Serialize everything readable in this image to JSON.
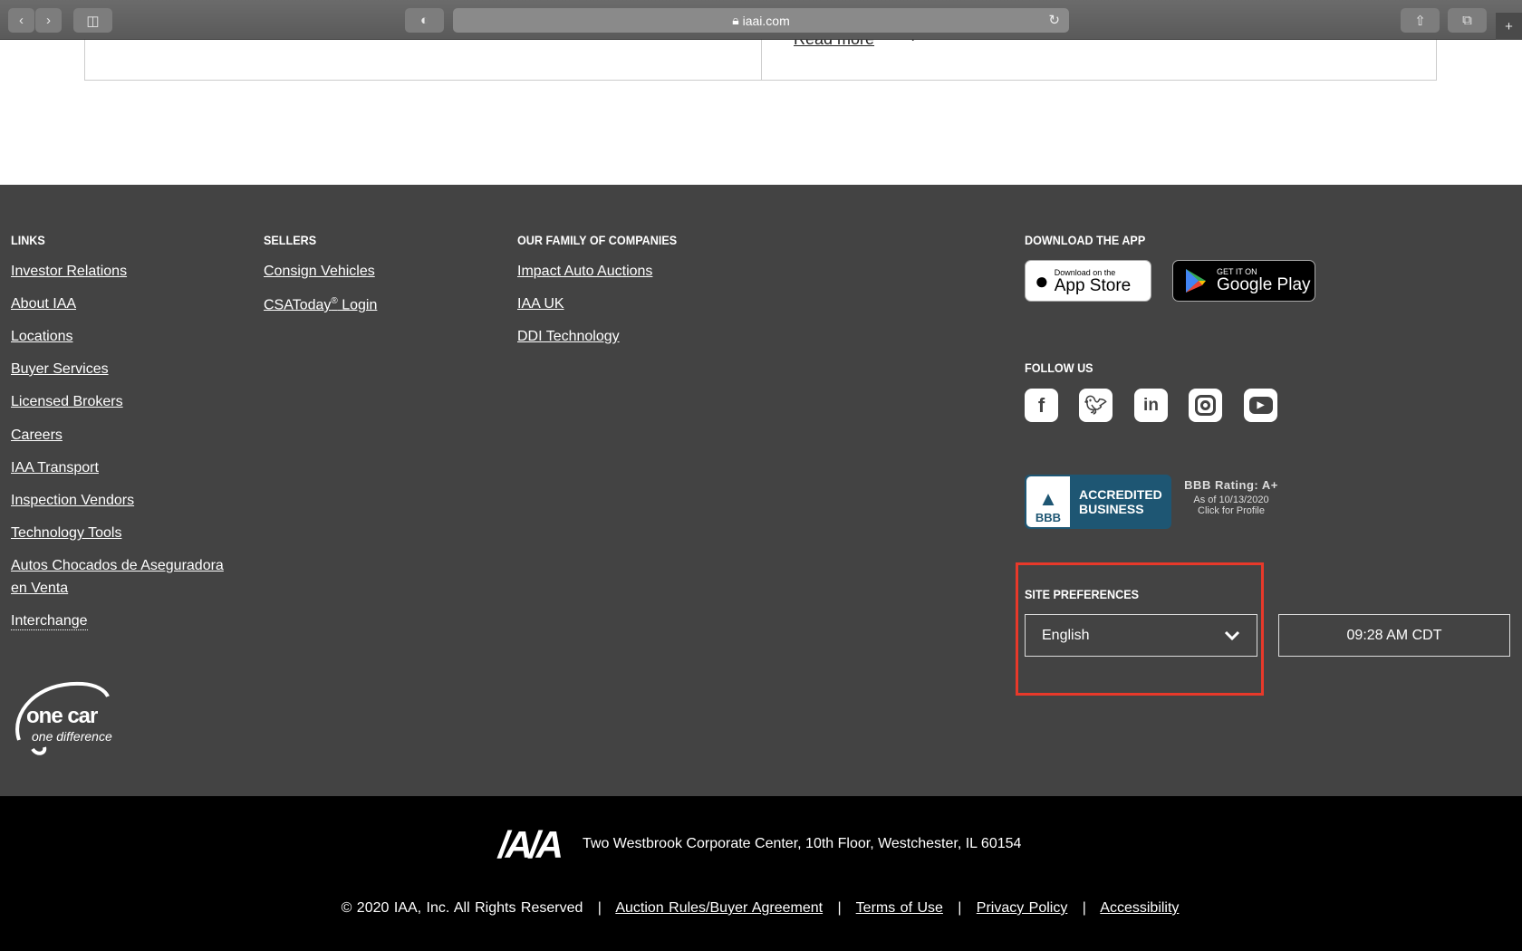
{
  "browser": {
    "url": "iaai.com"
  },
  "card": {
    "read_more": "Read more"
  },
  "footer": {
    "links": {
      "heading": "LINKS",
      "items": [
        "Investor Relations",
        "About IAA",
        "Locations",
        "Buyer Services",
        "Licensed Brokers",
        "Careers",
        "IAA Transport",
        "Inspection Vendors",
        "Technology Tools",
        "Autos Chocados de Aseguradora",
        "en Venta",
        "Interchange"
      ]
    },
    "sellers": {
      "heading": "SELLERS",
      "items": [
        "Consign Vehicles",
        "CSAToday",
        "®",
        " Login"
      ]
    },
    "family": {
      "heading": "OUR FAMILY OF COMPANIES",
      "items": [
        "Impact Auto Auctions",
        "IAA UK",
        "DDI Technology"
      ]
    },
    "app": {
      "heading": "DOWNLOAD THE APP",
      "appstore_small": "Download on the",
      "appstore": "App Store",
      "google_small": "GET IT ON",
      "google": "Google Play"
    },
    "follow": {
      "heading": "FOLLOW US",
      "icons": [
        "facebook-icon",
        "twitter-icon",
        "linkedin-icon",
        "instagram-icon",
        "youtube-icon"
      ]
    },
    "bbb": {
      "line1": "ACCREDITED",
      "line2": "BUSINESS",
      "logo": "BBB",
      "rating": "BBB Rating: A+",
      "as_of": "As of 10/13/2020",
      "profile": "Click for Profile"
    },
    "prefs": {
      "heading": "SITE PREFERENCES",
      "language": "English",
      "time": "09:28 AM CDT",
      "highlight_color": "#e8392a"
    },
    "slogan": {
      "line1": "one car",
      "line2": "one difference"
    }
  },
  "bottom": {
    "address": "Two Westbrook Corporate Center, 10th Floor, Westchester, IL 60154",
    "copyright": "© 2020 IAA, Inc. All Rights Reserved",
    "sep": "|",
    "links": [
      "Auction Rules/Buyer Agreement",
      "Terms of Use",
      "Privacy Policy",
      "Accessibility"
    ]
  }
}
